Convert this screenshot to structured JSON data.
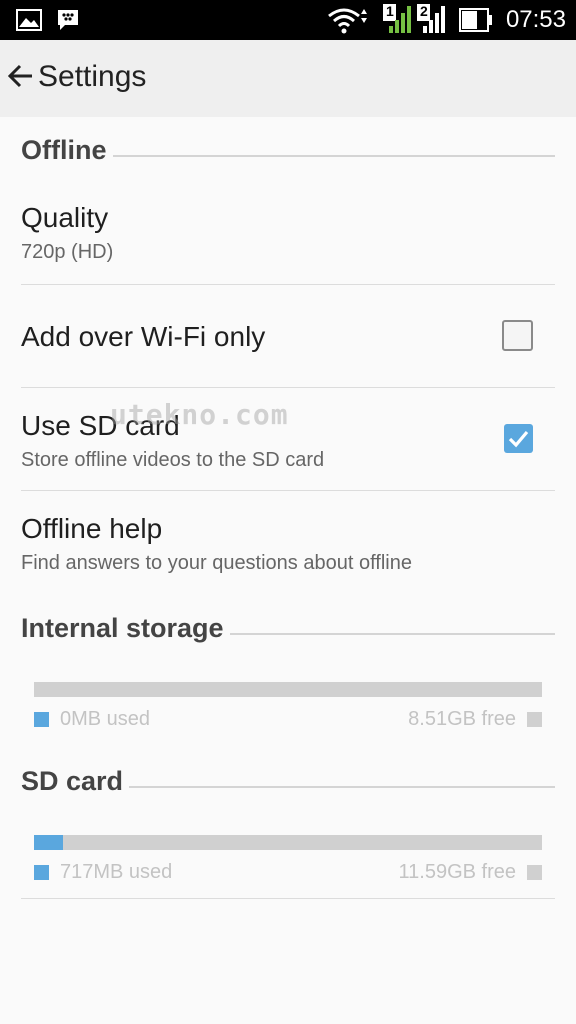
{
  "status_bar": {
    "time": "07:53",
    "sim1": "1",
    "sim2": "2",
    "icons": [
      "image-icon",
      "bbm-icon",
      "wifi-icon",
      "signal-sim1-icon",
      "signal-sim2-icon",
      "battery-icon"
    ]
  },
  "toolbar": {
    "back_icon": "arrow-left-icon",
    "title": "Settings"
  },
  "offline_section": {
    "header": "Offline",
    "quality": {
      "title": "Quality",
      "value": "720p (HD)"
    },
    "wifi_only": {
      "title": "Add over Wi-Fi only",
      "checked": false
    },
    "use_sd": {
      "title": "Use SD card",
      "subtitle": "Store offline videos to the SD card",
      "checked": true
    },
    "help": {
      "title": "Offline help",
      "subtitle": "Find answers to your questions about offline"
    }
  },
  "internal_storage": {
    "header": "Internal storage",
    "used": "0MB used",
    "free": "8.51GB free",
    "used_fraction": 0
  },
  "sd_card": {
    "header": "SD card",
    "used": "717MB used",
    "free": "11.59GB free",
    "used_fraction": 0.057
  },
  "watermark": "utekno.com",
  "colors": {
    "accent": "#5aa7de",
    "bar_track": "#d0d0d0",
    "free_square": "#d0d0d0"
  }
}
